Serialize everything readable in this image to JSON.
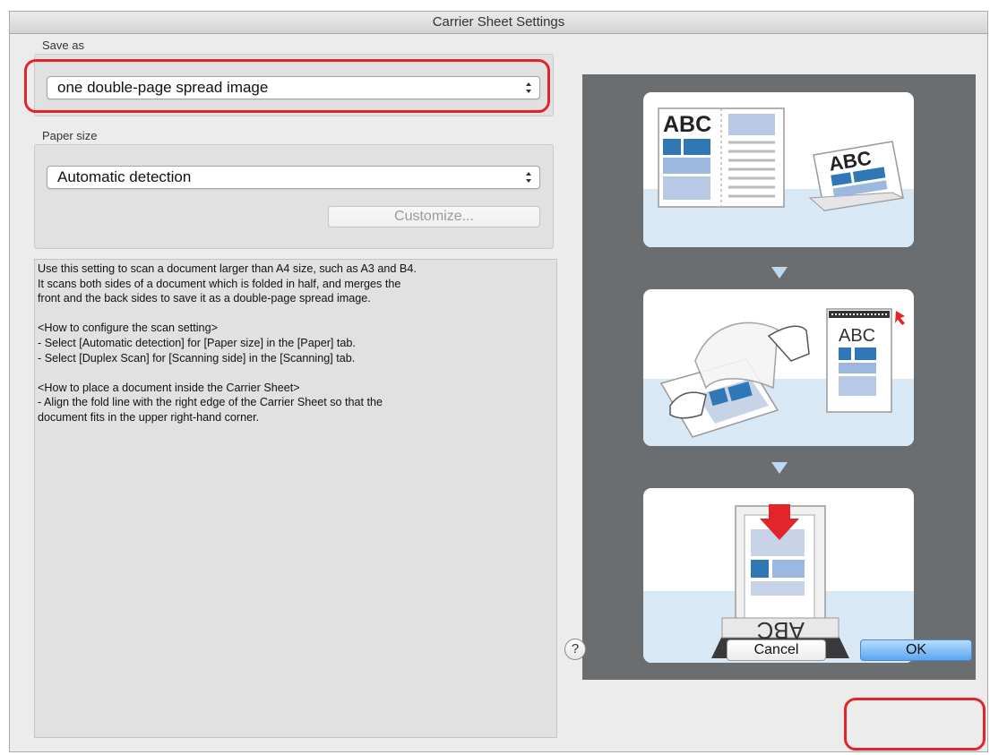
{
  "window": {
    "title": "Carrier Sheet Settings"
  },
  "save_as": {
    "label": "Save as",
    "selected": "one double-page spread image"
  },
  "paper_size": {
    "label": "Paper size",
    "selected": "Automatic detection",
    "customize_label": "Customize..."
  },
  "description": {
    "para1": [
      "Use this setting to scan a document larger than A4 size, such as A3 and B4.",
      "It scans both sides of a document which is folded in half, and merges the",
      "front and the back sides to save it as a double-page spread image."
    ],
    "para2": [
      "<How to configure the scan setting>",
      "- Select [Automatic detection] for [Paper size] in the [Paper] tab.",
      "- Select [Duplex Scan] for [Scanning side] in the [Scanning] tab."
    ],
    "para3": [
      "<How to place a document inside the Carrier Sheet>",
      "- Align the fold line with the right edge of the Carrier Sheet so that the",
      "document fits in the upper right-hand corner."
    ]
  },
  "illustration": {
    "abc_text": "ABC",
    "reversed_text": "ABC",
    "colors": {
      "background": "#6b6e70",
      "accent_blue": "#2f77b5",
      "light_blue": "#9cb8e0",
      "arrow_red": "#e2242b"
    }
  },
  "buttons": {
    "help": "?",
    "cancel": "Cancel",
    "ok": "OK"
  },
  "icons": [
    "popup-arrows-icon",
    "help-icon",
    "down-triangle-icon"
  ]
}
